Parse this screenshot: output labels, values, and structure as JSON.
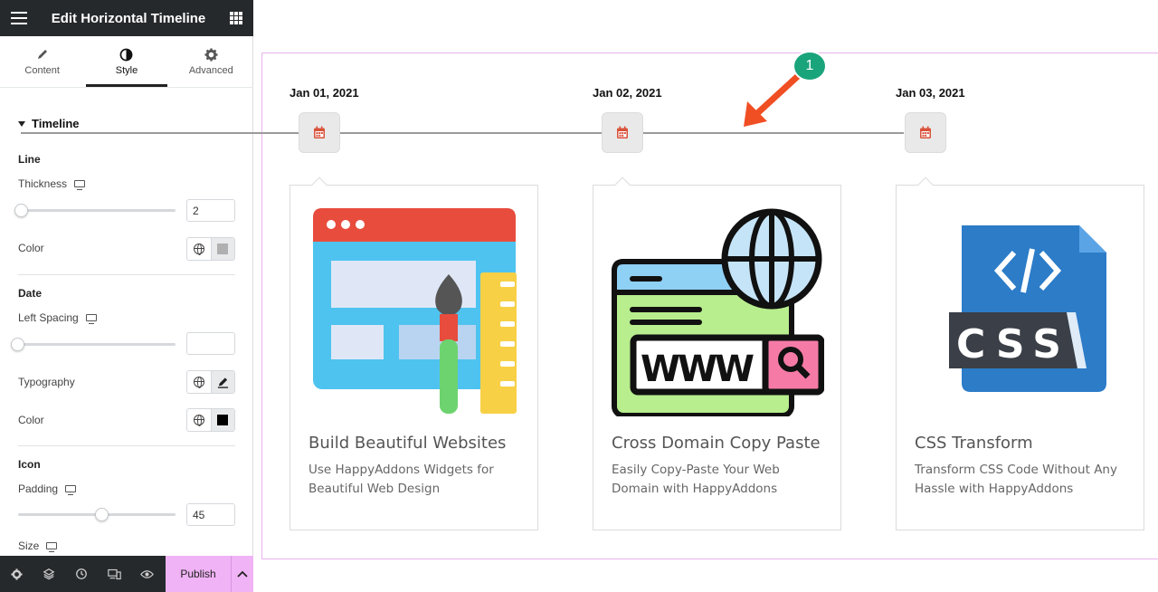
{
  "panel": {
    "title": "Edit Horizontal Timeline",
    "tabs": [
      {
        "label": "Content"
      },
      {
        "label": "Style"
      },
      {
        "label": "Advanced"
      }
    ],
    "section_title": "Timeline",
    "line": {
      "heading": "Line",
      "thickness_label": "Thickness",
      "thickness_value": "2",
      "thickness_level": 0.02,
      "color_label": "Color",
      "color_swatch": "#b0b0b0"
    },
    "date": {
      "heading": "Date",
      "left_spacing_label": "Left Spacing",
      "left_spacing_value": "",
      "typography_label": "Typography",
      "color_label": "Color",
      "color_swatch": "#000000"
    },
    "icon": {
      "heading": "Icon",
      "padding_label": "Padding",
      "padding_value": "45",
      "padding_level": 0.5,
      "size_label": "Size"
    },
    "bottom": {
      "publish_label": "Publish"
    }
  },
  "timeline": {
    "accent": "#d9523b",
    "line_color": "#9a9a9a",
    "items": [
      {
        "date": "Jan 01, 2021",
        "title": "Build Beautiful Websites",
        "description": "Use HappyAddons Widgets for Beautiful Web Design",
        "image": "web-design-illustration"
      },
      {
        "date": "Jan 02, 2021",
        "title": "Cross Domain Copy Paste",
        "description": "Easily Copy-Paste Your Web Domain with HappyAddons",
        "image": "www-browser-globe-illustration"
      },
      {
        "date": "Jan 03, 2021",
        "title": "CSS Transform",
        "description": "Transform CSS Code Without Any Hassle with HappyAddons",
        "image": "css-file-illustration"
      }
    ]
  },
  "annotation": {
    "badge_number": "1",
    "badge_color": "#1aa47b",
    "arrow_color": "#f04e23"
  }
}
